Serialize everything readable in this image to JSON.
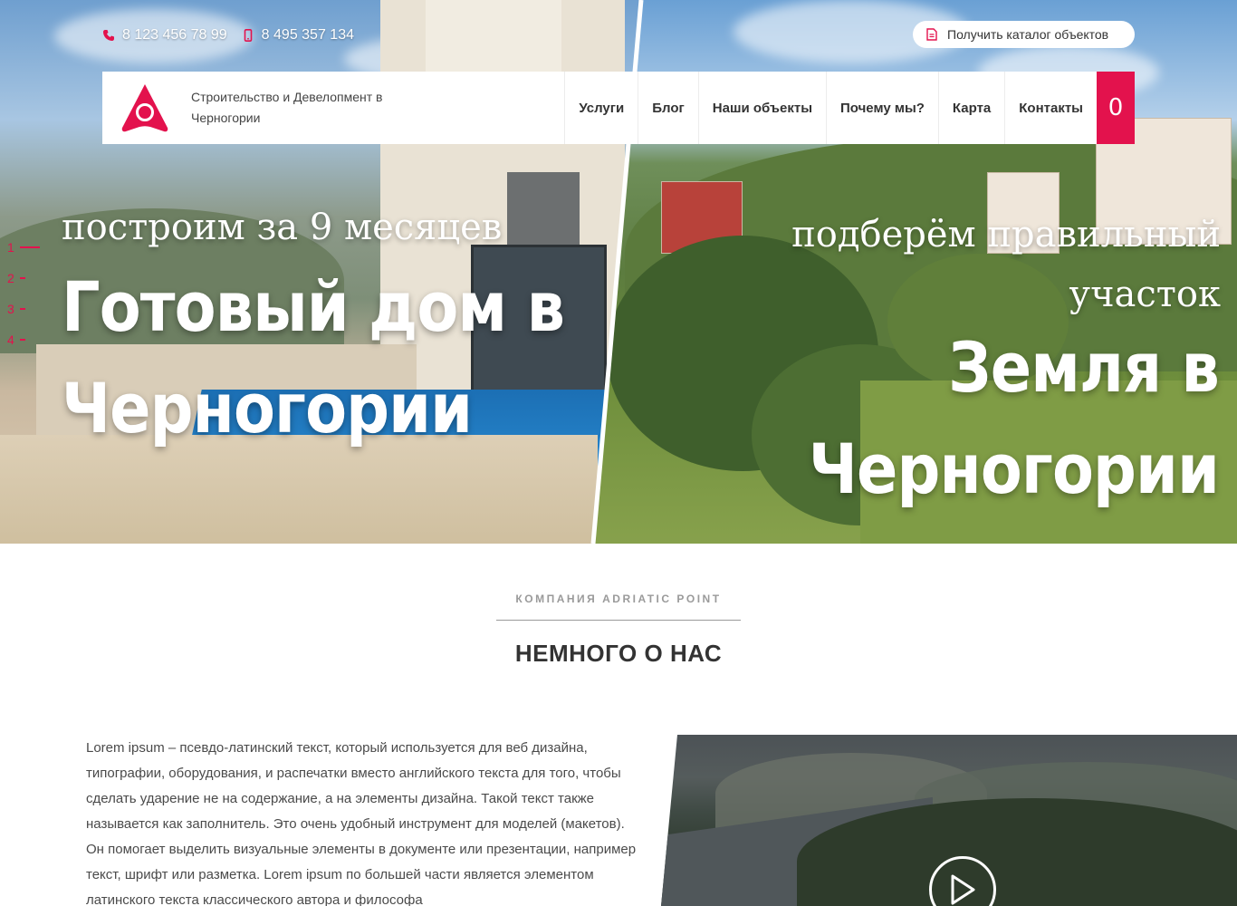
{
  "contacts": {
    "phone_1": "8 123 456 78 99",
    "phone_2": "8 495 357 134"
  },
  "catalog_button": {
    "label": "Получить каталог объектов",
    "icon": "document-icon"
  },
  "brand": {
    "tagline": "Строительство и Девелопмент в Черногории",
    "accent_color": "#e3124d"
  },
  "nav": {
    "items": [
      {
        "label": "Услуги"
      },
      {
        "label": "Блог"
      },
      {
        "label": "Наши объекты"
      },
      {
        "label": "Почему мы?"
      },
      {
        "label": "Карта"
      },
      {
        "label": "Контакты"
      }
    ],
    "cart_count": "0"
  },
  "slider": {
    "indicators": [
      "1",
      "2",
      "3",
      "4"
    ],
    "active_index": 1
  },
  "hero": {
    "left": {
      "subtitle": "построим за 9 месяцев",
      "title_line_1": "Готовый дом в",
      "title_line_2": "Черногории"
    },
    "right": {
      "subtitle_line_1": "подберём правильный",
      "subtitle_line_2": "участок",
      "title_line_1": "Земля в",
      "title_line_2": "Черногории"
    }
  },
  "about": {
    "eyebrow": "КОМПАНИЯ ADRIATIC POINT",
    "title": "НЕМНОГО О НАС",
    "text": "Lorem ipsum – псевдо-латинский текст, который используется для веб дизайна, типографии, оборудования, и распечатки вместо английского текста для того, чтобы сделать ударение не на содержание, а на элементы дизайна. Такой текст также называется как заполнитель. Это очень удобный инструмент для моделей (макетов). Он помогает выделить визуальные элементы в документе или презентации, например текст, шрифт или разметка. Lorem ipsum по большей части является элементом латинского текста классического автора и философа"
  },
  "video": {
    "play_icon": "play-icon"
  }
}
